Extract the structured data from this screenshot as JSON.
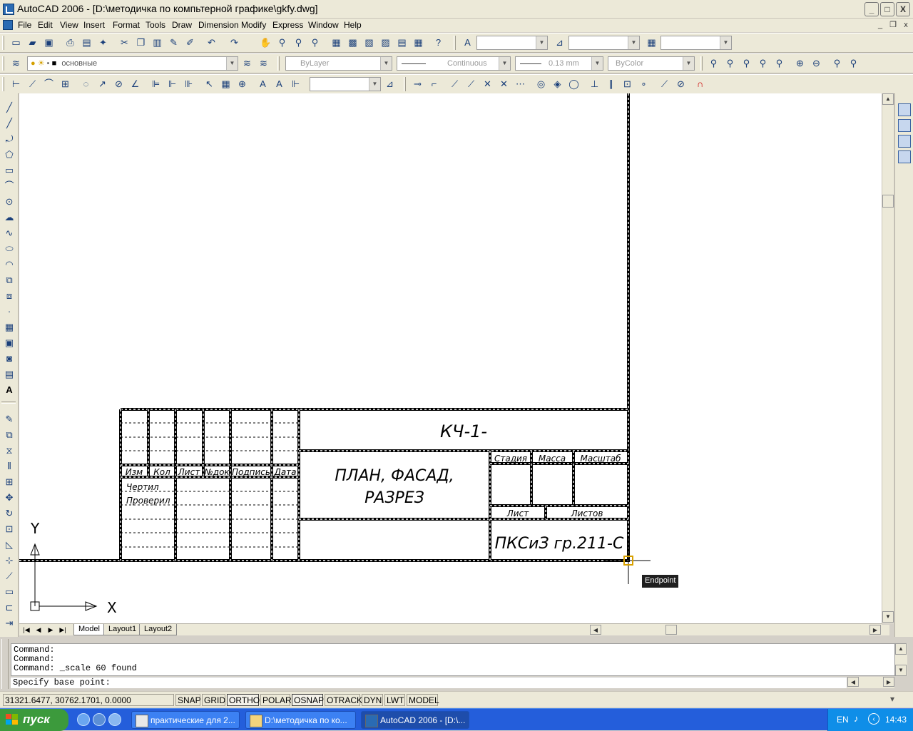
{
  "window": {
    "title": "AutoCAD 2006 - [D:\\методичка по компьтерной графике\\gkfy.dwg]",
    "buttons": {
      "minimize": "_",
      "maximize": "□",
      "close": "X"
    }
  },
  "menu": {
    "items": [
      "File",
      "Edit",
      "View",
      "Insert",
      "Format",
      "Tools",
      "Draw",
      "Dimension",
      "Modify",
      "Express",
      "Window",
      "Help"
    ],
    "doc_buttons": {
      "minimize": "_",
      "restore": "❐",
      "close": "x"
    }
  },
  "layers_toolbar": {
    "layer_combo": "основные",
    "color_combo": "ByLayer",
    "linetype_combo": "Continuous",
    "lineweight_combo": "0.13 mm",
    "plotstyle_combo": "ByColor"
  },
  "drawing": {
    "title_block": {
      "code": "КЧ-1-",
      "title_line1": "ПЛАН, ФАСАД,",
      "title_line2": "РАЗРЕЗ",
      "org": "ПКСиЗ гр.211-С",
      "header_cells": [
        "Изм",
        "Кол",
        "Лист",
        "№док",
        "Подпись",
        "Дата"
      ],
      "role_rows": [
        "Чертил",
        "Проверил"
      ],
      "stage_cells": [
        "Стадия",
        "Масса",
        "Масштаб"
      ],
      "sheet_cells": [
        "Лист",
        "Листов"
      ]
    },
    "ucs": {
      "y_label": "Y",
      "x_label": "X"
    },
    "osnap_tooltip": "Endpoint"
  },
  "layout_tabs": [
    "Model",
    "Layout1",
    "Layout2"
  ],
  "command_history": [
    "Command:",
    "Command:",
    "Command: _scale 60 found"
  ],
  "command_prompt": "Specify base point:",
  "status": {
    "coordinates": "31321.6477, 30762.1701, 0.0000",
    "toggles": [
      "SNAP",
      "GRID",
      "ORTHO",
      "POLAR",
      "OSNAP",
      "OTRACK",
      "DYN",
      "LWT",
      "MODEL"
    ],
    "on_toggles": [
      "ORTHO",
      "OSNAP"
    ]
  },
  "taskbar": {
    "start": "пуск",
    "tasks": [
      "практические для 2...",
      "D:\\методичка по ко...",
      "AutoCAD 2006 - [D:\\..."
    ],
    "active_task": 2,
    "lang": "EN",
    "clock": "14:43"
  },
  "colors": {
    "taskbar": "#245edb",
    "start": "#3c9a3c",
    "chrome": "#ece9d8"
  }
}
